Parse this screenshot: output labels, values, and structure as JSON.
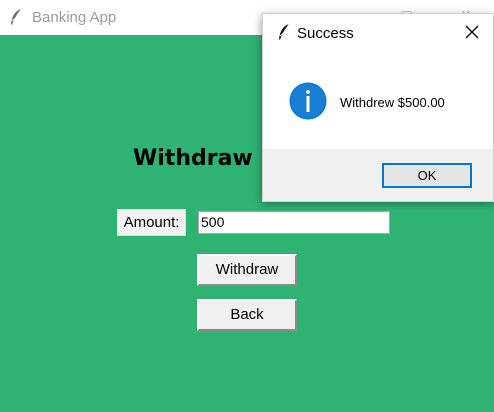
{
  "app": {
    "title": "Banking App",
    "background_color": "#2eb373"
  },
  "main": {
    "heading": "Withdraw",
    "amount_label": "Amount:",
    "amount_value": "500",
    "withdraw_button": "Withdraw",
    "back_button": "Back"
  },
  "dialog": {
    "title": "Success",
    "message": "Withdrew $500.00",
    "ok_button": "OK",
    "icon": "info-icon",
    "accent_color": "#0078d7"
  }
}
